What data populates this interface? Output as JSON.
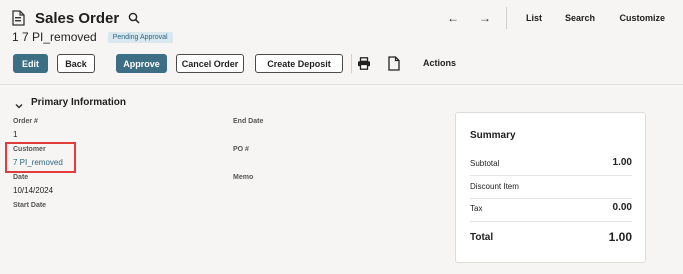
{
  "header": {
    "title": "Sales Order",
    "record_name": "1 7 PI_removed",
    "status": "Pending Approval",
    "nav_back_arrow": "←",
    "nav_forward_arrow": "→",
    "links": {
      "list": "List",
      "search": "Search",
      "customize": "Customize"
    }
  },
  "toolbar": {
    "edit": "Edit",
    "back": "Back",
    "approve": "Approve",
    "cancel_order": "Cancel Order",
    "create_deposit": "Create Deposit",
    "actions": "Actions"
  },
  "section": {
    "title": "Primary Information",
    "fields": {
      "order_no_label": "Order #",
      "order_no_value": "1",
      "customer_label": "Customer",
      "customer_value": "7 PI_removed",
      "date_label": "Date",
      "date_value": "10/14/2024",
      "start_date_label": "Start Date",
      "end_date_label": "End Date",
      "po_label": "PO #",
      "memo_label": "Memo"
    }
  },
  "summary": {
    "title": "Summary",
    "subtotal_label": "Subtotal",
    "subtotal_value": "1.00",
    "discount_label": "Discount Item",
    "tax_label": "Tax",
    "tax_value": "0.00",
    "total_label": "Total",
    "total_value": "1.00"
  },
  "colors": {
    "primary_button": "#3c6e84",
    "link": "#2b6582",
    "badge_bg": "#d9e8ef",
    "highlight": "#e03c3c"
  }
}
